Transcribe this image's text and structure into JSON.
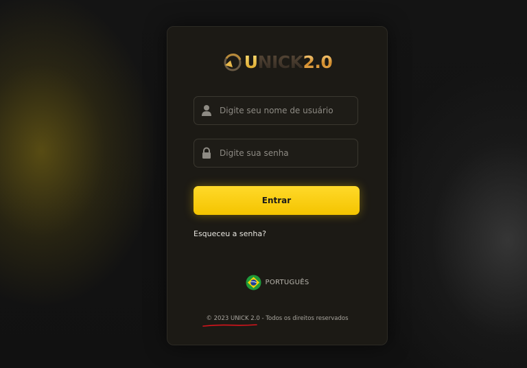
{
  "login": {
    "logo": {
      "brand_highlight": "U",
      "brand_rest": "NICK",
      "version": "2.0"
    },
    "username_field": {
      "placeholder": "Digite seu nome de usuário",
      "value": ""
    },
    "password_field": {
      "placeholder": "Digite sua senha",
      "value": ""
    },
    "submit_label": "Entrar",
    "forgot_password_label": "Esqueceu a senha?",
    "language": {
      "label": "PORTUGUÊS",
      "flag_icon": "brazil-flag-icon"
    },
    "footer_text": "© 2023 UNICK 2.0 - Todos os direitos reservados"
  },
  "icons": {
    "username": "user-icon",
    "password": "lock-icon"
  },
  "colors": {
    "background": "#121212",
    "card": "#1c1a15",
    "accent_yellow": "#f6c800",
    "button_text": "#1a1a1a",
    "annotation_red": "#d8141c"
  }
}
